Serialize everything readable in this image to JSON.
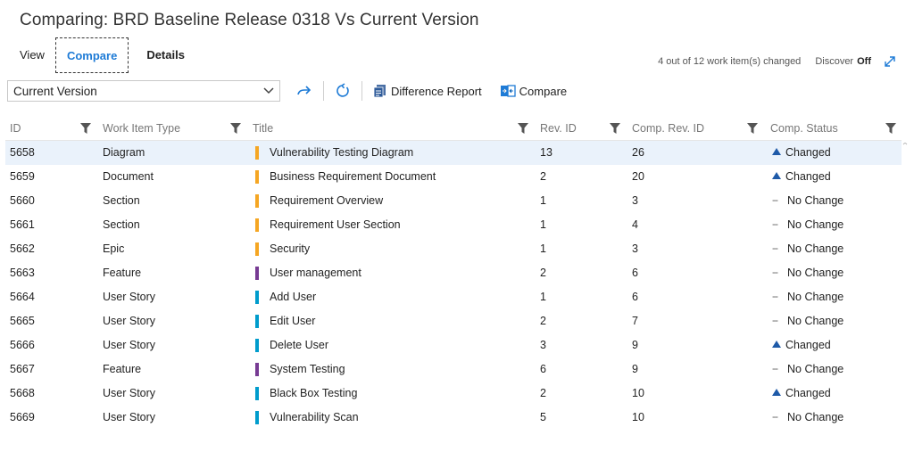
{
  "header": {
    "title": "Comparing: BRD Baseline Release 0318 Vs Current Version"
  },
  "tabs": [
    {
      "label": "View"
    },
    {
      "label": "Compare"
    },
    {
      "label": "Details"
    }
  ],
  "summary": {
    "changed_info": "4 out of 12 work item(s) changed",
    "discover_label": "Discover",
    "discover_value": "Off"
  },
  "toolbar": {
    "version_select": "Current Version",
    "difference_report_label": "Difference Report",
    "compare_label": "Compare"
  },
  "columns": [
    "ID",
    "Work Item Type",
    "Title",
    "Rev. ID",
    "Comp. Rev. ID",
    "Comp. Status"
  ],
  "type_colors": {
    "Diagram": "#f5a623",
    "Document": "#f5a623",
    "Section": "#f5a623",
    "Epic": "#f5a623",
    "Feature": "#773b93",
    "User Story": "#009ccc"
  },
  "rows": [
    {
      "id": "5658",
      "type": "Diagram",
      "title": "Vulnerability Testing Diagram",
      "rev": "13",
      "comp_rev": "26",
      "status": "Changed"
    },
    {
      "id": "5659",
      "type": "Document",
      "title": "Business Requirement Document",
      "rev": "2",
      "comp_rev": "20",
      "status": "Changed"
    },
    {
      "id": "5660",
      "type": "Section",
      "title": "Requirement Overview",
      "rev": "1",
      "comp_rev": "3",
      "status": "No Change"
    },
    {
      "id": "5661",
      "type": "Section",
      "title": "Requirement User Section",
      "rev": "1",
      "comp_rev": "4",
      "status": "No Change"
    },
    {
      "id": "5662",
      "type": "Epic",
      "title": "Security",
      "rev": "1",
      "comp_rev": "3",
      "status": "No Change"
    },
    {
      "id": "5663",
      "type": "Feature",
      "title": "User management",
      "rev": "2",
      "comp_rev": "6",
      "status": "No Change"
    },
    {
      "id": "5664",
      "type": "User Story",
      "title": "Add User",
      "rev": "1",
      "comp_rev": "6",
      "status": "No Change"
    },
    {
      "id": "5665",
      "type": "User Story",
      "title": "Edit User",
      "rev": "2",
      "comp_rev": "7",
      "status": "No Change"
    },
    {
      "id": "5666",
      "type": "User Story",
      "title": "Delete User",
      "rev": "3",
      "comp_rev": "9",
      "status": "Changed"
    },
    {
      "id": "5667",
      "type": "Feature",
      "title": "System Testing",
      "rev": "6",
      "comp_rev": "9",
      "status": "No Change"
    },
    {
      "id": "5668",
      "type": "User Story",
      "title": "Black Box Testing",
      "rev": "2",
      "comp_rev": "10",
      "status": "Changed"
    },
    {
      "id": "5669",
      "type": "User Story",
      "title": "Vulnerability Scan",
      "rev": "5",
      "comp_rev": "10",
      "status": "No Change"
    }
  ]
}
